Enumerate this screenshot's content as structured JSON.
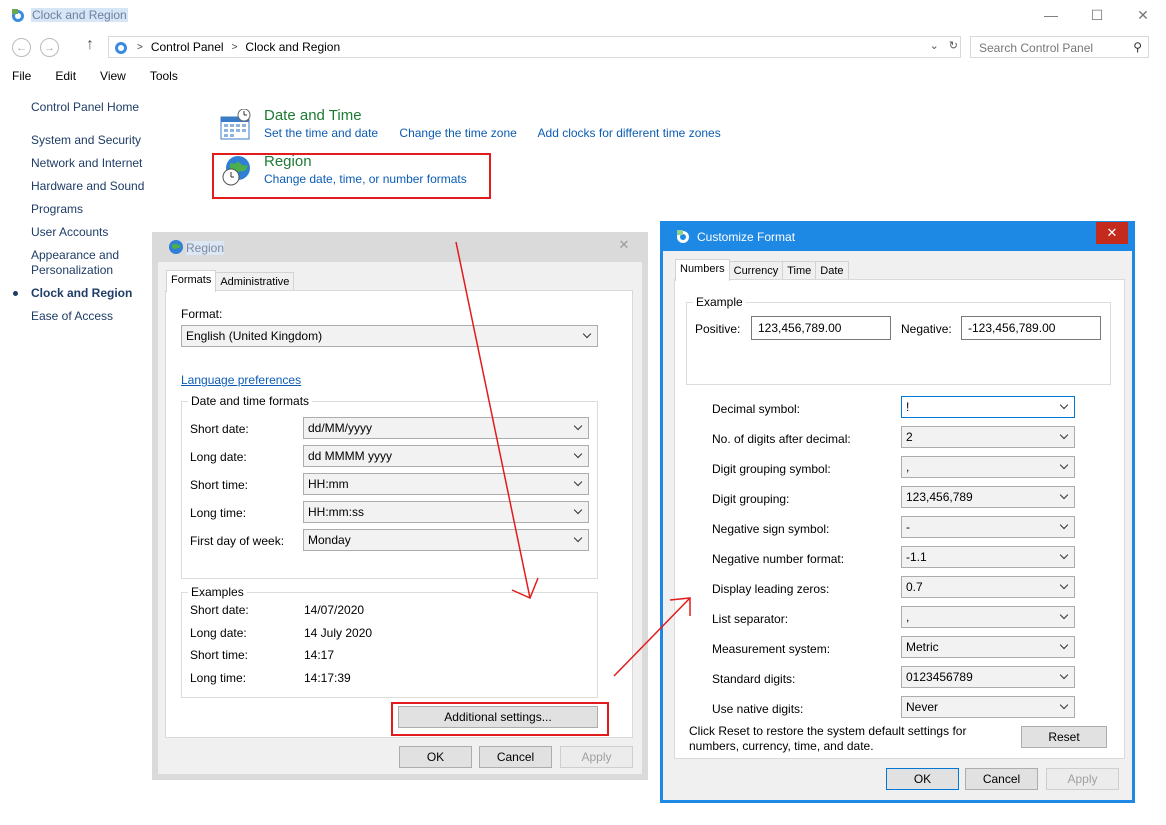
{
  "window": {
    "title": "Clock and Region",
    "minimize": "—",
    "maximize": "☐",
    "close": "✕"
  },
  "address": {
    "crumbs": [
      "Control Panel",
      "Clock and Region"
    ],
    "search_placeholder": "Search Control Panel"
  },
  "menu": [
    "File",
    "Edit",
    "View",
    "Tools"
  ],
  "sidebar": {
    "home": "Control Panel Home",
    "items": [
      "System and Security",
      "Network and Internet",
      "Hardware and Sound",
      "Programs",
      "User Accounts",
      "Appearance and Personalization",
      "Clock and Region",
      "Ease of Access"
    ],
    "active": "Clock and Region"
  },
  "categories": {
    "datetime": {
      "title": "Date and Time",
      "links": [
        "Set the time and date",
        "Change the time zone",
        "Add clocks for different time zones"
      ]
    },
    "region": {
      "title": "Region",
      "links": [
        "Change date, time, or number formats"
      ]
    }
  },
  "region_dialog": {
    "title": "Region",
    "tabs": [
      "Formats",
      "Administrative"
    ],
    "format_label": "Format:",
    "format_value": "English (United Kingdom)",
    "language_link": "Language preferences",
    "dt_group": "Date and time formats",
    "dt_fields": [
      {
        "label": "Short date:",
        "value": "dd/MM/yyyy"
      },
      {
        "label": "Long date:",
        "value": "dd MMMM yyyy"
      },
      {
        "label": "Short time:",
        "value": "HH:mm"
      },
      {
        "label": "Long time:",
        "value": "HH:mm:ss"
      },
      {
        "label": "First day of week:",
        "value": "Monday"
      }
    ],
    "examples_group": "Examples",
    "examples": [
      {
        "label": "Short date:",
        "value": "14/07/2020"
      },
      {
        "label": "Long date:",
        "value": "14 July 2020"
      },
      {
        "label": "Short time:",
        "value": "14:17"
      },
      {
        "label": "Long time:",
        "value": "14:17:39"
      }
    ],
    "additional_button": "Additional settings...",
    "ok": "OK",
    "cancel": "Cancel",
    "apply": "Apply"
  },
  "customize_dialog": {
    "title": "Customize Format",
    "tabs": [
      "Numbers",
      "Currency",
      "Time",
      "Date"
    ],
    "example_group": "Example",
    "positive_label": "Positive:",
    "positive_value": "123,456,789.00",
    "negative_label": "Negative:",
    "negative_value": "-123,456,789.00",
    "settings": [
      {
        "label": "Decimal symbol:",
        "value": "!"
      },
      {
        "label": "No. of digits after decimal:",
        "value": "2"
      },
      {
        "label": "Digit grouping symbol:",
        "value": ","
      },
      {
        "label": "Digit grouping:",
        "value": "123,456,789"
      },
      {
        "label": "Negative sign symbol:",
        "value": "-"
      },
      {
        "label": "Negative number format:",
        "value": "-1.1"
      },
      {
        "label": "Display leading zeros:",
        "value": "0.7"
      },
      {
        "label": "List separator:",
        "value": ","
      },
      {
        "label": "Measurement system:",
        "value": "Metric"
      },
      {
        "label": "Standard digits:",
        "value": "0123456789"
      },
      {
        "label": "Use native digits:",
        "value": "Never"
      }
    ],
    "reset_text": "Click Reset to restore the system default settings for numbers, currency, time, and date.",
    "reset_button": "Reset",
    "ok": "OK",
    "cancel": "Cancel",
    "apply": "Apply"
  },
  "colors": {
    "accent_blue": "#1e88e5",
    "annotation_red": "#e21c1c",
    "link_blue": "#0c5cb5",
    "category_green": "#1e7a35"
  }
}
